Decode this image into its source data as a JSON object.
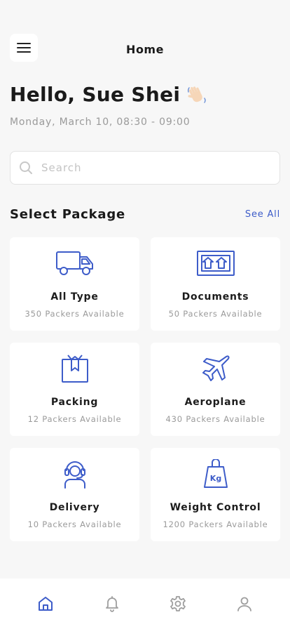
{
  "header": {
    "title": "Home",
    "menu_icon": "hamburger-menu-icon"
  },
  "greeting": {
    "text": "Hello, Sue Shei",
    "emoji_icon": "waving-hand-icon"
  },
  "schedule": "Monday, March 10, 08:30 - 09:00",
  "search": {
    "placeholder": "Search",
    "value": "",
    "icon": "search-icon"
  },
  "section": {
    "title": "Select Package",
    "see_all": "See All"
  },
  "packages": [
    {
      "name": "All Type",
      "count": "350 Packers Available",
      "icon": "truck-icon"
    },
    {
      "name": "Documents",
      "count": "50 Packers Available",
      "icon": "documents-box-icon"
    },
    {
      "name": "Packing",
      "count": "12 Packers Available",
      "icon": "gift-box-icon"
    },
    {
      "name": "Aeroplane",
      "count": "430 Packers Available",
      "icon": "aeroplane-icon"
    },
    {
      "name": "Delivery",
      "count": "10 Packers Available",
      "icon": "headset-agent-icon"
    },
    {
      "name": "Weight Control",
      "count": "1200 Packers Available",
      "icon": "kg-weight-icon"
    }
  ],
  "bottom_nav": [
    {
      "name": "home",
      "icon": "home-icon",
      "active": true
    },
    {
      "name": "notifications",
      "icon": "bell-icon",
      "active": false
    },
    {
      "name": "settings",
      "icon": "gear-icon",
      "active": false
    },
    {
      "name": "profile",
      "icon": "user-icon",
      "active": false
    }
  ],
  "colors": {
    "accent": "#3d5cc9",
    "background": "#f7f7f7",
    "card": "#ffffff",
    "muted_text": "#9a9a9a",
    "inactive_icon": "#9e9e9e"
  }
}
